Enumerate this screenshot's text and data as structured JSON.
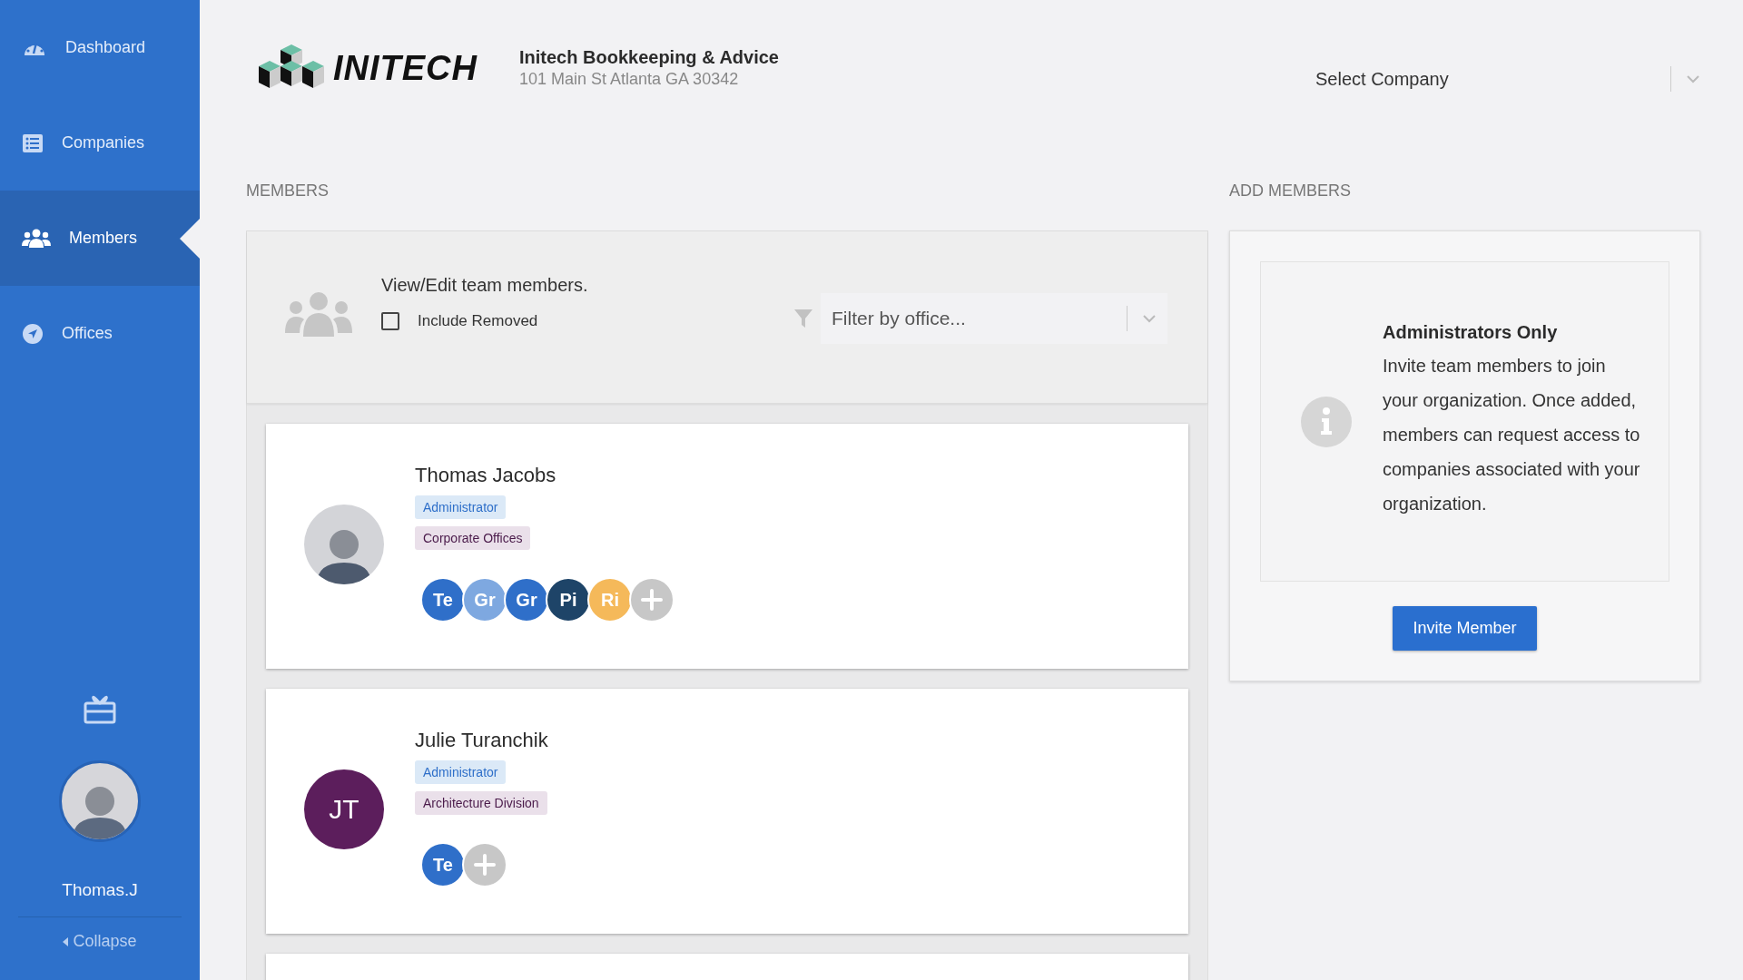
{
  "sidebar": {
    "items": [
      {
        "label": "Dashboard",
        "selected": false
      },
      {
        "label": "Companies",
        "selected": false
      },
      {
        "label": "Members",
        "selected": true
      },
      {
        "label": "Offices",
        "selected": false
      }
    ],
    "user": {
      "name": "Thomas.J"
    },
    "collapse": "Collapse"
  },
  "header": {
    "logo": "INITECH",
    "company_name": "Initech Bookkeeping & Advice",
    "company_address": "101 Main St Atlanta GA 30342",
    "company_select": {
      "placeholder": "Select Company"
    }
  },
  "members": {
    "title": "MEMBERS",
    "intro": "View/Edit team members.",
    "include_removed": {
      "label": "Include Removed",
      "checked": false
    },
    "office_filter": {
      "placeholder": "Filter by office..."
    },
    "list": [
      {
        "name": "Thomas Jacobs",
        "avatar": {
          "kind": "photo"
        },
        "role": "Administrator",
        "office": "Corporate Offices",
        "companies": [
          {
            "initials": "Te",
            "color": "#2f6fc9"
          },
          {
            "initials": "Gr",
            "color": "#7ea8e0"
          },
          {
            "initials": "Gr",
            "color": "#2f6fc9"
          },
          {
            "initials": "Pi",
            "color": "#1e4468"
          },
          {
            "initials": "Ri",
            "color": "#f5b95a"
          }
        ]
      },
      {
        "name": "Julie Turanchik",
        "avatar": {
          "kind": "initials",
          "initials": "JT"
        },
        "role": "Administrator",
        "office": "Architecture Division",
        "companies": [
          {
            "initials": "Te",
            "color": "#2f6fc9"
          }
        ]
      }
    ]
  },
  "add_members": {
    "title": "ADD MEMBERS",
    "heading": "Administrators Only",
    "body": "Invite team members to join your organization. Once added, members can request access to companies associated with your organization.",
    "button": "Invite Member"
  }
}
